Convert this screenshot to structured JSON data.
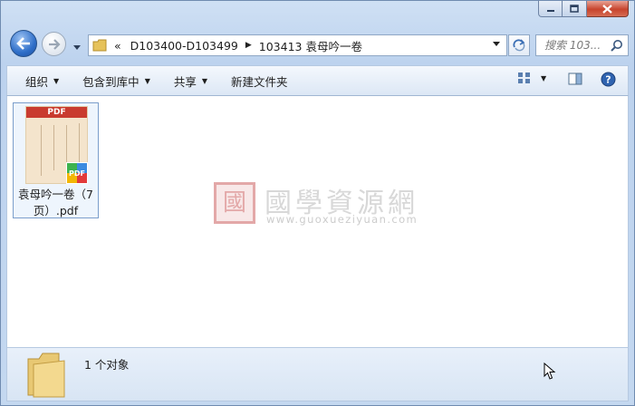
{
  "window": {
    "caption_icons": [
      "minimize-icon",
      "maximize-icon",
      "close-icon"
    ]
  },
  "address_bar": {
    "chevron": "«",
    "breadcrumbs": [
      "D103400-D103499",
      "103413 袁母吟一卷"
    ]
  },
  "search": {
    "placeholder": "搜索 103..."
  },
  "toolbar": {
    "organize": "组织",
    "include_in_library": "包含到库中",
    "share": "共享",
    "new_folder": "新建文件夹"
  },
  "files": [
    {
      "name": "袁母吟一卷（7页）.pdf",
      "thumb_label": "PDF",
      "badge": "PDF"
    }
  ],
  "watermark": {
    "seal": "國",
    "title": "國學資源網",
    "url": "www.guoxueziyuan.com"
  },
  "details": {
    "count": "1 个对象"
  },
  "colors": {
    "pdf_red": "#c93b2f",
    "selection": "#7b9ecb",
    "close": "#c7442d"
  }
}
